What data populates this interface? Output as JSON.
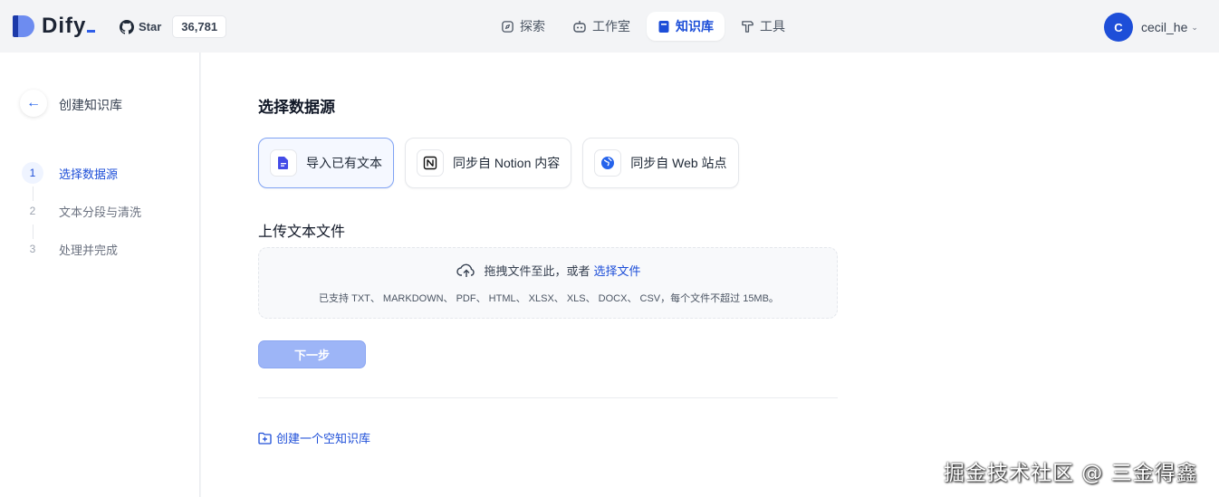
{
  "header": {
    "logo_text": "Dify",
    "github": {
      "star_label": "Star",
      "star_count": "36,781"
    },
    "nav": [
      {
        "label": "探索",
        "icon": "explore-icon",
        "active": false
      },
      {
        "label": "工作室",
        "icon": "robot-icon",
        "active": false
      },
      {
        "label": "知识库",
        "icon": "book-icon",
        "active": true
      },
      {
        "label": "工具",
        "icon": "hammer-icon",
        "active": false
      }
    ],
    "user": {
      "avatar_letter": "C",
      "name": "cecil_he"
    }
  },
  "sidebar": {
    "title": "创建知识库",
    "steps": [
      {
        "num": "1",
        "label": "选择数据源",
        "active": true
      },
      {
        "num": "2",
        "label": "文本分段与清洗",
        "active": false
      },
      {
        "num": "3",
        "label": "处理并完成",
        "active": false
      }
    ]
  },
  "main": {
    "title": "选择数据源",
    "sources": [
      {
        "label": "导入已有文本",
        "icon": "file-text-icon",
        "selected": true
      },
      {
        "label": "同步自 Notion 内容",
        "icon": "notion-icon",
        "selected": false
      },
      {
        "label": "同步自 Web 站点",
        "icon": "globe-icon",
        "selected": false
      }
    ],
    "upload_title": "上传文本文件",
    "dropzone": {
      "prompt": "拖拽文件至此，或者",
      "link": "选择文件",
      "hint": "已支持 TXT、 MARKDOWN、 PDF、 HTML、 XLSX、 XLS、 DOCX、 CSV，每个文件不超过 15MB。"
    },
    "next_button": "下一步",
    "empty_kb_link": "创建一个空知识库"
  },
  "watermark": "掘金技术社区 @ 三金得鑫",
  "colors": {
    "accent": "#1d4ed8",
    "next_button_disabled": "#9db5f7",
    "selected_bg": "#f5f8ff"
  }
}
